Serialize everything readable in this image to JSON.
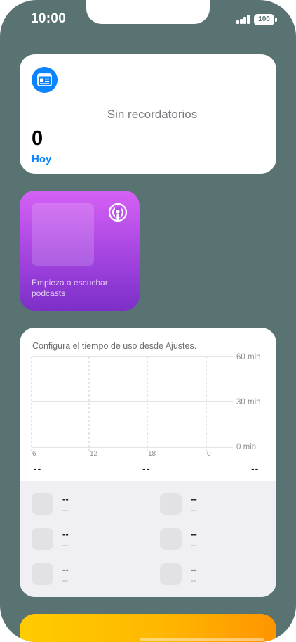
{
  "status_bar": {
    "time": "10:00",
    "battery": "100"
  },
  "reminders_widget": {
    "empty_text": "Sin recordatorios",
    "count": "0",
    "day_label": "Hoy",
    "icon": "reminders-list-icon",
    "accent_color": "#0a84ff"
  },
  "podcasts_widget": {
    "prompt": "Empieza a escuchar podcasts",
    "icon": "podcasts-icon"
  },
  "screen_time_widget": {
    "message": "Configura el tiempo de uso desde Ajustes.",
    "chart_y_labels": [
      "60 min",
      "30 min",
      "0 min"
    ],
    "chart_x_labels": [
      "6",
      "12",
      "18",
      "0"
    ],
    "summary_placeholders": [
      "--",
      "--",
      "--"
    ],
    "apps": [
      {
        "name": "--",
        "time": "--"
      },
      {
        "name": "--",
        "time": "--"
      },
      {
        "name": "--",
        "time": "--"
      },
      {
        "name": "--",
        "time": "--"
      },
      {
        "name": "--",
        "time": "--"
      },
      {
        "name": "--",
        "time": "--"
      }
    ]
  },
  "colors": {
    "wallpaper": "#587371",
    "podcasts_gradient": [
      "#d661f5",
      "#7c2fc8"
    ],
    "bottom_widget_gradient": [
      "#ffcc00",
      "#ff9500"
    ]
  }
}
